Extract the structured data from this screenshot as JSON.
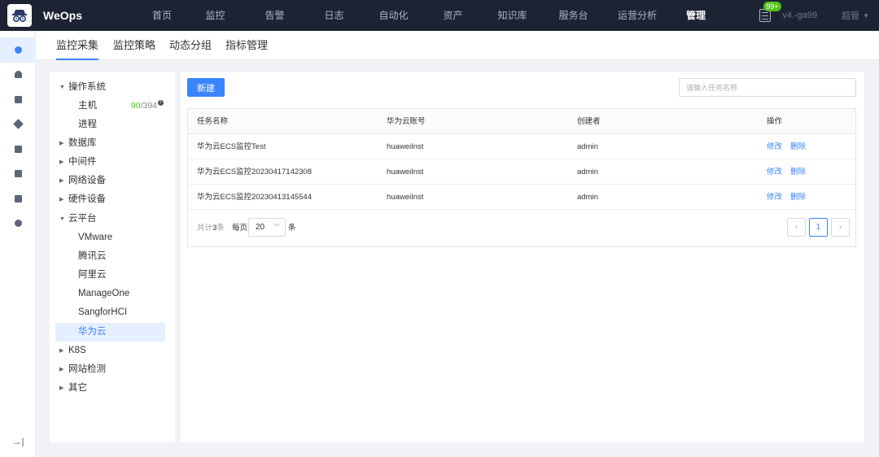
{
  "app": {
    "logo_text": "WeOps"
  },
  "nav": {
    "items": [
      "首页",
      "监控",
      "告警",
      "日志",
      "自动化",
      "资产",
      "知识库",
      "服务台",
      "运营分析",
      "管理"
    ],
    "active_index": 9
  },
  "top_right": {
    "notification_count": "99+",
    "version": "v4.-ga99",
    "user": "超管"
  },
  "icon_sidebar": {
    "items": [
      "monitor-icon",
      "alarm-icon",
      "box-icon",
      "layers-icon",
      "book-icon",
      "clipboard-icon",
      "clipboard-check-icon",
      "settings-hex-icon"
    ],
    "collapse_label": "→|"
  },
  "subtabs": [
    "监控采集",
    "监控策略",
    "动态分组",
    "指标管理"
  ],
  "tree": {
    "os": "操作系统",
    "host": "主机",
    "host_count_used": "90",
    "host_count_total": "/394",
    "process": "进程",
    "database": "数据库",
    "middleware": "中间件",
    "network": "网络设备",
    "hardware": "硬件设备",
    "cloud": "云平台",
    "cloud_items": [
      "VMware",
      "腾讯云",
      "阿里云",
      "ManageOne",
      "SangforHCI",
      "华为云"
    ],
    "k8s": "K8S",
    "website": "网站检测",
    "other": "其它"
  },
  "toolbar": {
    "new_label": "新建",
    "search_placeholder": "请输入任务名称"
  },
  "table": {
    "headers": [
      "任务名称",
      "华为云账号",
      "创建者",
      "操作"
    ],
    "rows": [
      {
        "name": "华为云ECS监控Test",
        "account": "huaweiInst",
        "creator": "admin"
      },
      {
        "name": "华为云ECS监控20230417142308",
        "account": "huaweiInst",
        "creator": "admin"
      },
      {
        "name": "华为云ECS监控20230413145544",
        "account": "huaweiInst",
        "creator": "admin"
      }
    ],
    "action_edit": "修改",
    "action_delete": "删除"
  },
  "pagination": {
    "total_prefix": "共计",
    "total": "3",
    "total_suffix": "条",
    "per_page_label": "每页",
    "page_size": "20",
    "unit": "条",
    "current_page": "1"
  }
}
